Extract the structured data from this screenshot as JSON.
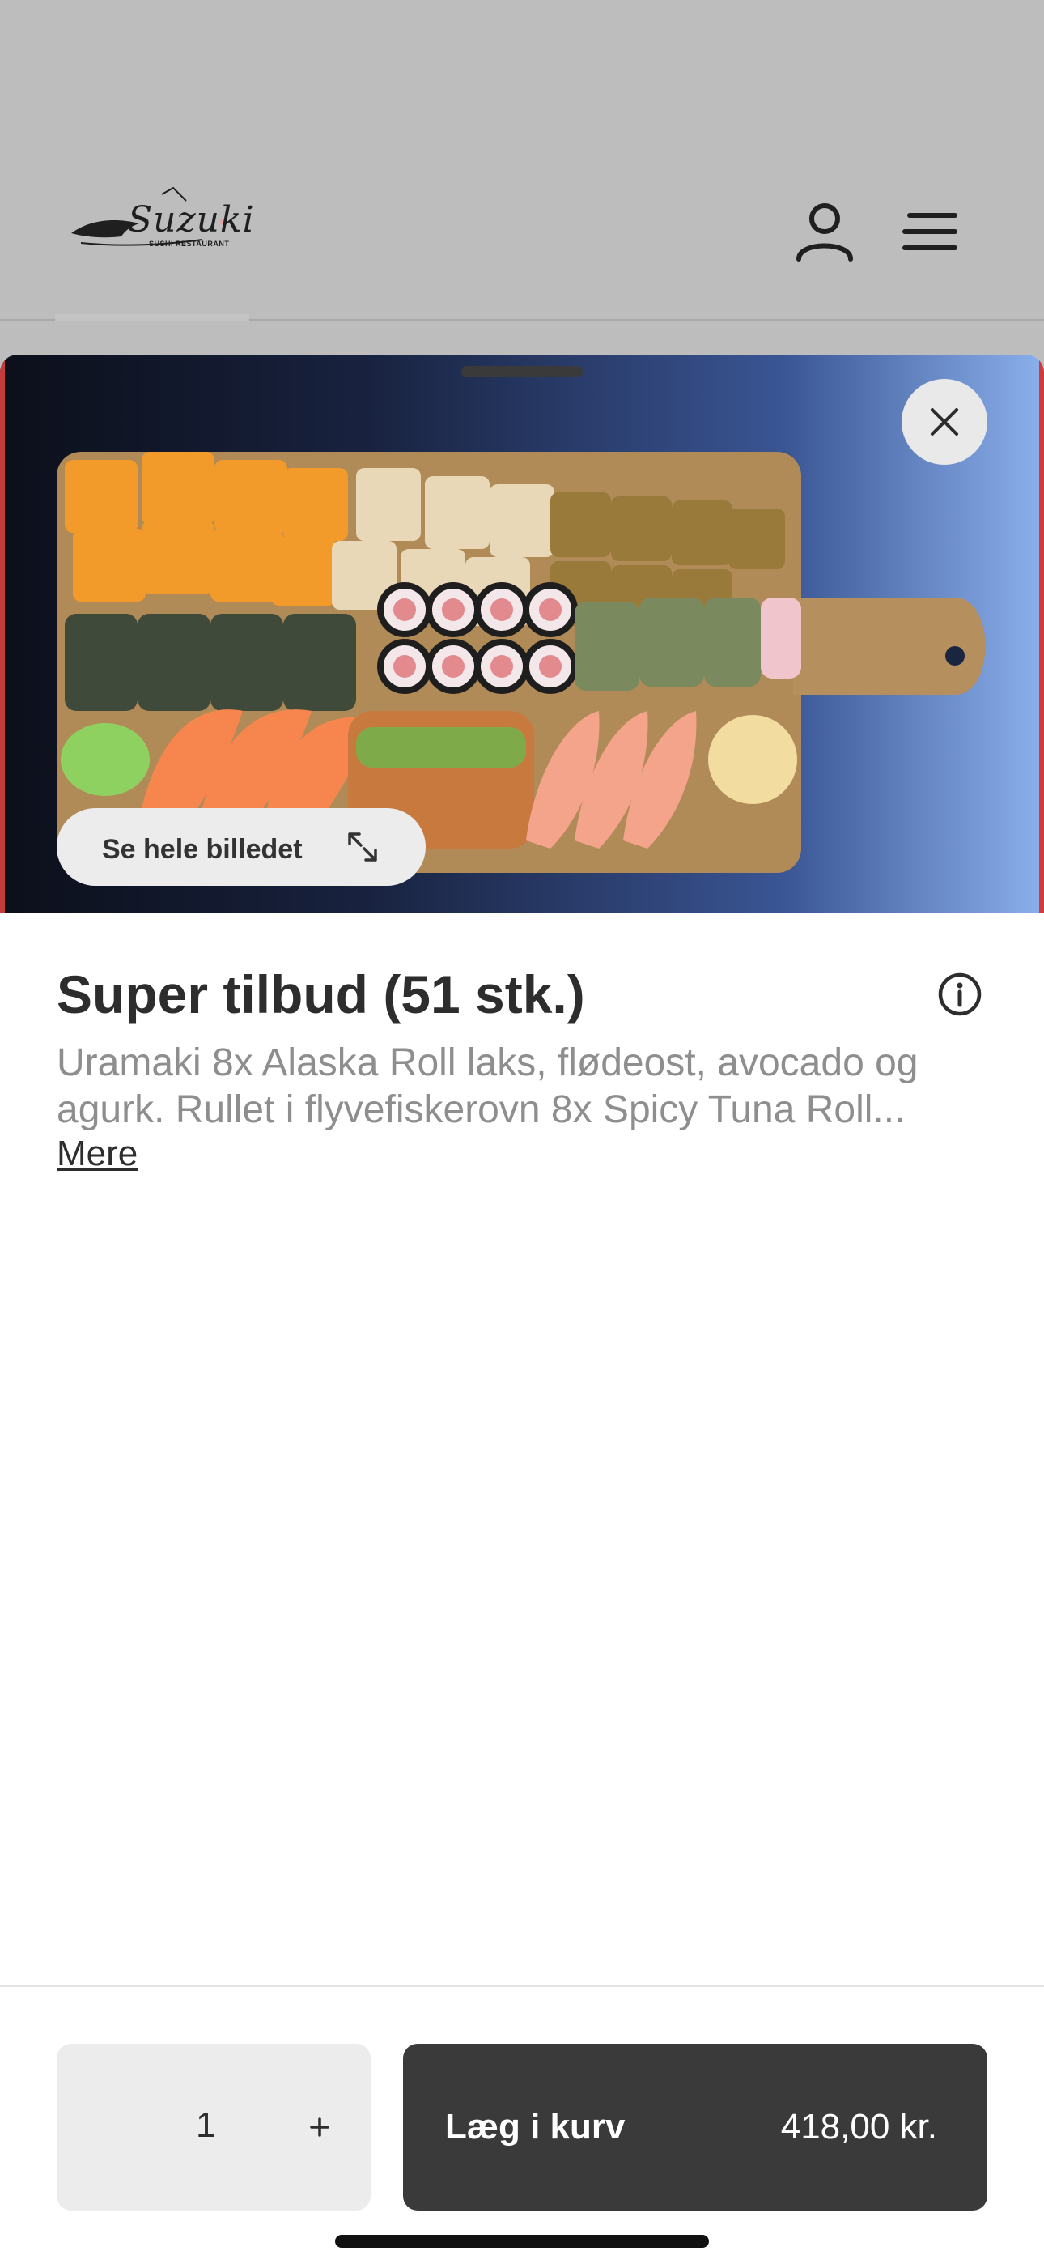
{
  "header": {
    "logo": {
      "brand": "Suzuki",
      "tagline": "SUSHI RESTAURANT"
    },
    "account_icon": "user-icon",
    "menu_icon": "hamburger-menu-icon"
  },
  "sheet": {
    "close_icon": "close-icon",
    "view_image_label": "Se hele billedet",
    "expand_icon": "expand-icon",
    "product": {
      "title": "Super tilbud (51 stk.)",
      "description_lines": [
        "Uramaki 8x Alaska Roll laks, flødeost, avocado og",
        "agurk. Rullet i flyvefiskerovn 8x Spicy Tuna Roll..."
      ],
      "more_label": "Mere",
      "info_icon": "info-icon"
    }
  },
  "footer": {
    "quantity": "1",
    "plus_icon": "plus-icon",
    "add_to_cart_label": "Læg i kurv",
    "price": "418,00 kr."
  },
  "colors": {
    "overlay_bg": "#bdbdbd",
    "primary_button": "#3a3a3a",
    "quantity_bg": "#ececec",
    "title_text": "#2d2d2d",
    "description_text": "#8e8e8e"
  }
}
